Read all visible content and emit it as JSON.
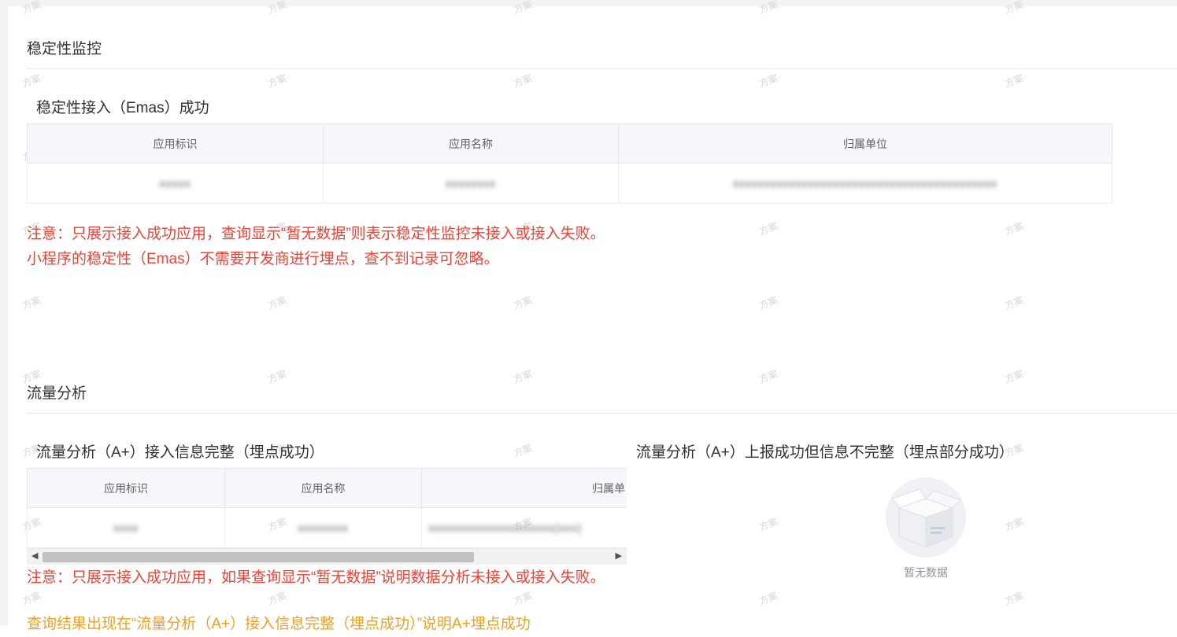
{
  "stability": {
    "section_title": "稳定性监控",
    "sub_title": "稳定性接入（Emas）成功",
    "columns": [
      "应用标识",
      "应用名称",
      "归属单位"
    ],
    "rows": [
      [
        "xxxxx",
        "xxxxxxxx",
        "xxxxxxxxxxxxxxxxxxxxxxxxxxxxxxxxxxxxxxxxxx"
      ]
    ],
    "note_line1": "注意：只展示接入成功应用，查询显示“暂无数据”则表示稳定性监控未接入或接入失败。",
    "note_line2": "小程序的稳定性（Emas）不需要开发商进行埋点，查不到记录可忽略。"
  },
  "traffic": {
    "section_title": "流量分析",
    "left_title": "流量分析（A+）接入信息完整（埋点成功）",
    "left_columns": [
      "应用标识",
      "应用名称",
      "归属单"
    ],
    "left_rows": [
      [
        "xxxx",
        "xxxxxxxx",
        "xxxxxxxxxxxxxxxxxxxx(xxx)"
      ]
    ],
    "right_title": "流量分析（A+）上报成功但信息不完整（埋点部分成功）",
    "empty_text": "暂无数据",
    "note_red": "注意：只展示接入成功应用，如果查询显示“暂无数据”说明数据分析未接入或接入失败。",
    "note_orange": "查询结果出现在“流量分析（A+）接入信息完整（埋点成功）”说明A+埋点成功"
  },
  "watermark": "方案",
  "colors": {
    "note_red": "#f04134",
    "note_orange": "#f0a020",
    "header_bg": "#f5f7fa"
  }
}
